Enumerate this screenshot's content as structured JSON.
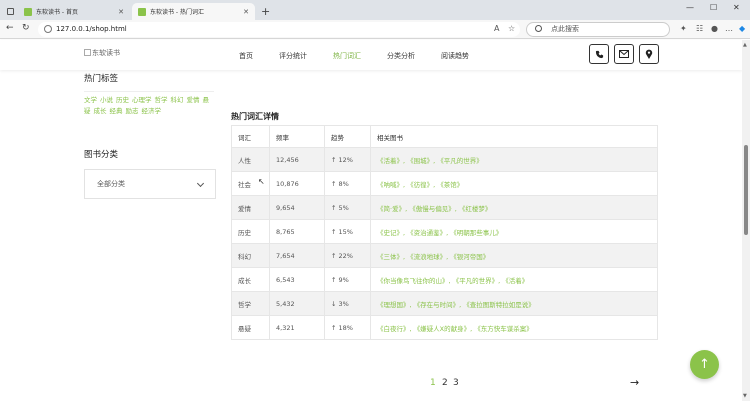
{
  "browser": {
    "tabs": [
      {
        "label": "东软读书 - 首页"
      },
      {
        "label": "东软读书 - 热门词汇"
      }
    ],
    "url": "127.0.0.1/shop.html",
    "search_placeholder": "点此搜索"
  },
  "site": {
    "logo_alt": "东软读书",
    "nav": [
      "首页",
      "评分统计",
      "热门词汇",
      "分类分析",
      "阅读趋势"
    ],
    "active_nav": "热门词汇"
  },
  "sidebar": {
    "tags_heading": "热门标签",
    "tags": [
      "文学",
      "小说",
      "历史",
      "心理学",
      "哲学",
      "科幻",
      "爱情",
      "悬疑",
      "成长",
      "经典",
      "励志",
      "经济学"
    ],
    "category_heading": "图书分类",
    "category_value": "全部分类"
  },
  "table": {
    "title": "热门词汇详情",
    "headers": [
      "词汇",
      "频率",
      "趋势",
      "相关图书"
    ],
    "rows": [
      {
        "word": "人性",
        "freq": "12,456",
        "trend": "↑ 12%",
        "books": "《活着》, 《围城》, 《平凡的世界》"
      },
      {
        "word": "社会",
        "freq": "10,876",
        "trend": "↑ 8%",
        "books": "《呐喊》, 《彷徨》, 《茶馆》"
      },
      {
        "word": "爱情",
        "freq": "9,654",
        "trend": "↑ 5%",
        "books": "《简·爱》, 《傲慢与偏见》, 《红楼梦》"
      },
      {
        "word": "历史",
        "freq": "8,765",
        "trend": "↑ 15%",
        "books": "《史记》, 《资治通鉴》, 《明朝那些事儿》"
      },
      {
        "word": "科幻",
        "freq": "7,654",
        "trend": "↑ 22%",
        "books": "《三体》, 《流浪地球》, 《银河帝国》"
      },
      {
        "word": "成长",
        "freq": "6,543",
        "trend": "↑ 9%",
        "books": "《你当像鸟飞往你的山》, 《平凡的世界》, 《活着》"
      },
      {
        "word": "哲学",
        "freq": "5,432",
        "trend": "↓ 3%",
        "books": "《理想国》, 《存在与时间》, 《查拉图斯特拉如是说》"
      },
      {
        "word": "悬疑",
        "freq": "4,321",
        "trend": "↑ 18%",
        "books": "《白夜行》, 《嫌疑人X的献身》, 《东方快车谋杀案》"
      }
    ]
  },
  "pagination": {
    "pages": [
      "1",
      "2",
      "3"
    ],
    "current": "1"
  },
  "colors": {
    "accent": "#8bc34a"
  }
}
